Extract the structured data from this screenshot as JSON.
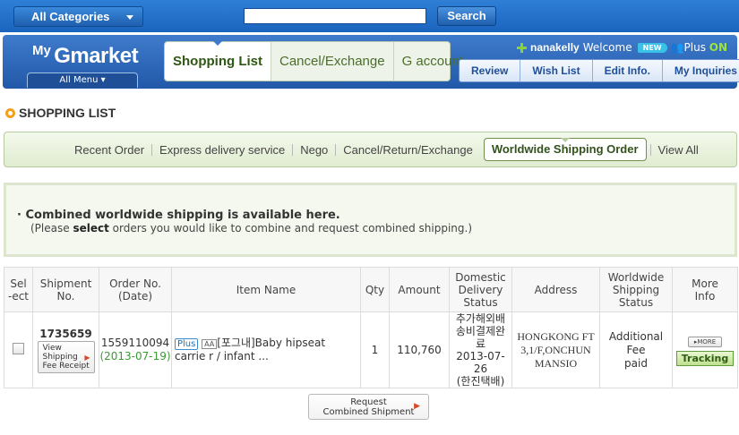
{
  "topbar": {
    "all_categories": "All Categories",
    "search_placeholder": "",
    "search_button": "Search"
  },
  "header": {
    "logo_my": "My",
    "logo_gmarket": "Gmarket",
    "all_menu": "All Menu",
    "main_tabs": [
      "Shopping List",
      "Cancel/Exchange",
      "G account"
    ],
    "active_tab": "Shopping List",
    "username": "nanakelly",
    "welcome": "Welcome",
    "new_badge": "NEW",
    "plus_label": "Plus",
    "plus_status": "ON",
    "sub_nav": [
      "Review",
      "Wish List",
      "Edit Info.",
      "My Inquiries"
    ]
  },
  "page_title": "SHOPPING LIST",
  "filter_tabs": {
    "items": [
      "Recent Order",
      "Express delivery service",
      "Nego",
      "Cancel/Return/Exchange",
      "Worldwide Shipping Order",
      "View All"
    ],
    "active": "Worldwide Shipping Order"
  },
  "notice": {
    "line1": "Combined worldwide shipping is available here.",
    "line2_pre": "(Please ",
    "line2_bold": "select",
    "line2_post": " orders you would like to combine and request combined shipping.)"
  },
  "table": {
    "headers": [
      [
        "Sel",
        "-ect"
      ],
      [
        "Shipment",
        "No."
      ],
      [
        "Order No.",
        "(Date)"
      ],
      [
        "Item Name"
      ],
      [
        "Qty"
      ],
      [
        "Amount"
      ],
      [
        "Domestic",
        "Delivery",
        "Status"
      ],
      [
        "Address"
      ],
      [
        "Worldwide",
        "Shipping",
        "Status"
      ],
      [
        "More",
        "Info"
      ]
    ],
    "rows": [
      {
        "shipment_no": "1735659",
        "fee_receipt": [
          "View",
          "Shipping",
          "Fee Receipt"
        ],
        "order_no": "1559110094",
        "order_date": "(2013-07-19)",
        "plus_badge": "Plus",
        "people_icon": "AA",
        "item_name": "[포그내]Baby hipseat carrie r / infant ...",
        "qty": "1",
        "amount": "110,760",
        "domestic_status": [
          "추가해외배",
          "송비결제완",
          "료",
          "2013-07-26",
          "(한진택배)"
        ],
        "address": [
          "HONGKONG FT",
          "3,1/F,ONCHUN",
          "MANSIO"
        ],
        "worldwide_status": [
          "Additional",
          "Fee",
          "paid"
        ],
        "more_button": "MORE",
        "tracking_button": "Tracking"
      }
    ]
  },
  "combine_button": [
    "Request",
    "Combined Shipment"
  ],
  "colors": {
    "topbar_blue": "#1b64bd",
    "header_blue": "#2258a8",
    "accent_green": "#4b6e2a",
    "date_green": "#3a9a32",
    "title_ring_orange": "#f2a01a"
  }
}
